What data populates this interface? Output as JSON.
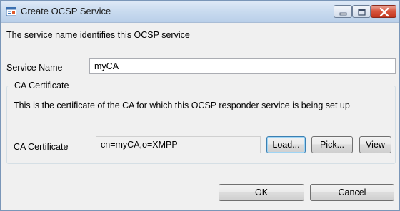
{
  "window": {
    "title": "Create OCSP Service"
  },
  "main": {
    "description": "The service name identifies this OCSP service",
    "service_name_label": "Service Name",
    "service_name_value": "myCA"
  },
  "ca_group": {
    "title": "CA Certificate",
    "description": "This is the certificate of the CA for which this OCSP responder service is being set up",
    "label": "CA Certificate",
    "value": "cn=myCA,o=XMPP",
    "load_label": "Load...",
    "pick_label": "Pick...",
    "view_label": "View"
  },
  "footer": {
    "ok_label": "OK",
    "cancel_label": "Cancel"
  },
  "icons": {
    "app": "app-window-icon",
    "minimize": "minimize-icon",
    "maximize": "maximize-icon",
    "close": "close-icon"
  }
}
